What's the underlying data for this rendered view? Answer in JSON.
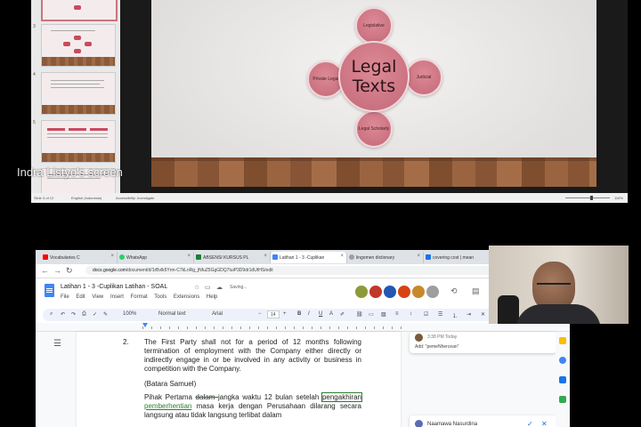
{
  "presentation": {
    "screen_label": "Indra Listyo's screen",
    "thumbnail_numbers": [
      "3",
      "4",
      "5"
    ],
    "slide": {
      "center": "Legal Texts",
      "top": "Legislative",
      "left": "Private Legal",
      "right": "Judicial",
      "bottom": "Legal Scholarly"
    },
    "status_left": "Slide 3 of 12",
    "status_lang": "English (Indonesia)",
    "status_access": "Accessibility: Investigate",
    "zoom": "116%",
    "accent": "#c36878"
  },
  "browser": {
    "tabs": [
      {
        "label": "Vocabularies C",
        "color": "#ff0000"
      },
      {
        "label": "WhatsApp",
        "color": "#25d366"
      },
      {
        "label": "ABSENSI KURSUS PL",
        "color": "#188038"
      },
      {
        "label": "Latihan 1 - 3 -Cuplikan",
        "color": "#4285f4"
      },
      {
        "label": "lingomen dictionary",
        "color": "#9aa0a6"
      },
      {
        "label": "covering cost | mean",
        "color": "#1a73e8"
      }
    ],
    "url_domain": "docs.google.com",
    "url_path": "/document/d/1rBvlk5Yrm-C7kLnRg_jNfuZ5GgGDQ7IuiP3D9dr1dUtHS/edit"
  },
  "docs": {
    "title": "Latihan 1 - 3 -Cuplikan Latihan - SOAL",
    "saving": "Saving...",
    "menu": [
      "File",
      "Edit",
      "View",
      "Insert",
      "Format",
      "Tools",
      "Extensions",
      "Help"
    ],
    "zoom": "100%",
    "style": "Normal text",
    "font": "Arial",
    "size": "14",
    "clause_number": "2.",
    "clause_text": "The First Party shall not for a period of 12 months following termination of employment with the Company either directly or indirectly engage in or be involved in any activity or business in competition with the Company.",
    "author": "(Batara Samuel)",
    "translation": {
      "p1": "Pihak Pertama ",
      "p1_strike": "dalam ",
      "p2": "jangka waktu 12 bulan setelah ",
      "p2_box": "pengakhiran",
      "p3": " ",
      "p3_sug": "pemberhentian",
      "p4": " masa kerja dengan Perusahaan dilarang secara langsung atau tidak langsung terlibat dalam"
    },
    "comment1": {
      "time": "3:38 PM Today",
      "text": "Add: \"pemeNhercean\""
    },
    "comment2": {
      "name": "Naamawa Nasurdina"
    }
  }
}
